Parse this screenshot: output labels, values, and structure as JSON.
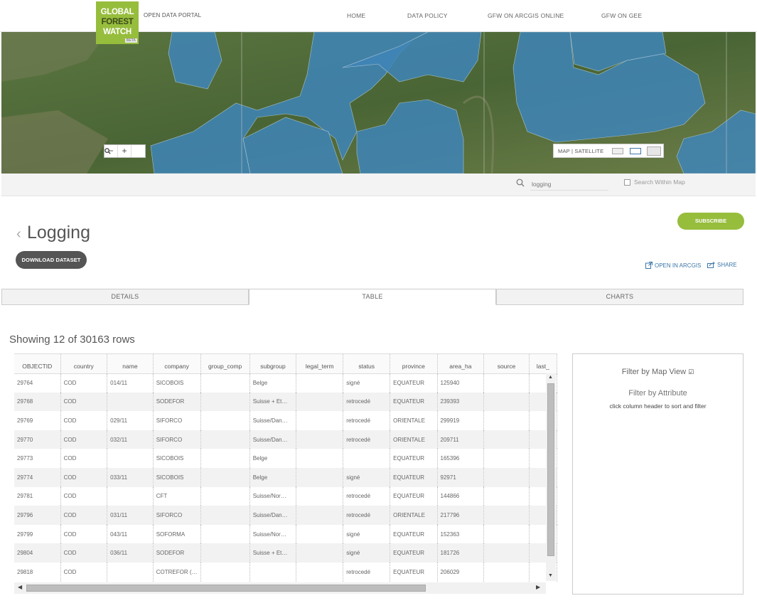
{
  "header": {
    "logo_lines": [
      "GLOBAL",
      "FOREST",
      "WATCH"
    ],
    "logo_badge": "BETA",
    "portal_label": "OPEN DATA PORTAL",
    "nav": [
      "HOME",
      "DATA POLICY",
      "GFW ON ARCGIS ONLINE",
      "GFW ON GEE"
    ]
  },
  "map": {
    "zoom_out": "−",
    "zoom_in": "+",
    "zoom_search_icon": "magnifier-icon",
    "basemap_label": "MAP | SATELLITE",
    "overlay_color": "#3f85b8",
    "land_color": "#55703a"
  },
  "search": {
    "value": "logging",
    "within_label": "Search Within Map"
  },
  "dataset": {
    "title": "Logging",
    "download_label": "DOWNLOAD DATASET",
    "subscribe_label": "SUBSCRIBE",
    "open_arcgis_label": "OPEN IN ARCGIS",
    "share_label": "SHARE"
  },
  "tabs": [
    "DETAILS",
    "TABLE",
    "CHARTS"
  ],
  "active_tab": "TABLE",
  "showing_text": "Showing 12 of 30163 rows",
  "table": {
    "columns": [
      "OBJECTID",
      "country",
      "name",
      "company",
      "group_comp",
      "subgroup",
      "legal_term",
      "status",
      "province",
      "area_ha",
      "source",
      "last_"
    ],
    "rows": [
      [
        "29764",
        "COD",
        "014/11",
        "SICOBOIS",
        "",
        "Belge",
        "",
        "signé",
        "EQUATEUR",
        "125940",
        "",
        ""
      ],
      [
        "29768",
        "COD",
        "",
        "SODEFOR",
        "",
        "Suisse + Et…",
        "",
        "retrocedé",
        "EQUATEUR",
        "239393",
        "",
        ""
      ],
      [
        "29769",
        "COD",
        "029/11",
        "SIFORCO",
        "",
        "Suisse/Dan…",
        "",
        "retrocedé",
        "ORIENTALE",
        "299919",
        "",
        ""
      ],
      [
        "29770",
        "COD",
        "032/11",
        "SIFORCO",
        "",
        "Suisse/Dan…",
        "",
        "retrocedé",
        "ORIENTALE",
        "209711",
        "",
        ""
      ],
      [
        "29773",
        "COD",
        "",
        "SICOBOIS",
        "",
        "Belge",
        "",
        "",
        "EQUATEUR",
        "165396",
        "",
        ""
      ],
      [
        "29774",
        "COD",
        "033/11",
        "SICOBOIS",
        "",
        "Belge",
        "",
        "signé",
        "EQUATEUR",
        "92971",
        "",
        ""
      ],
      [
        "29781",
        "COD",
        "",
        "CFT",
        "",
        "Suisse/Nor…",
        "",
        "retrocedé",
        "EQUATEUR",
        "144866",
        "",
        ""
      ],
      [
        "29796",
        "COD",
        "031/11",
        "SIFORCO",
        "",
        "Suisse/Dan…",
        "",
        "retrocedé",
        "ORIENTALE",
        "217796",
        "",
        ""
      ],
      [
        "29799",
        "COD",
        "043/11",
        "SOFORMA",
        "",
        "Suisse/Nor…",
        "",
        "signé",
        "EQUATEUR",
        "152363",
        "",
        ""
      ],
      [
        "29804",
        "COD",
        "036/11",
        "SODEFOR",
        "",
        "Suisse + Et…",
        "",
        "signé",
        "EQUATEUR",
        "181726",
        "",
        ""
      ],
      [
        "29818",
        "COD",
        "",
        "COTREFOR (…",
        "",
        "",
        "",
        "retrocedé",
        "EQUATEUR",
        "206029",
        "",
        ""
      ]
    ]
  },
  "filter_panel": {
    "map_view_label": "Filter by Map View",
    "map_view_checked_glyph": "☑",
    "attribute_label": "Filter by Attribute",
    "attribute_hint": "click column header to sort and filter"
  }
}
